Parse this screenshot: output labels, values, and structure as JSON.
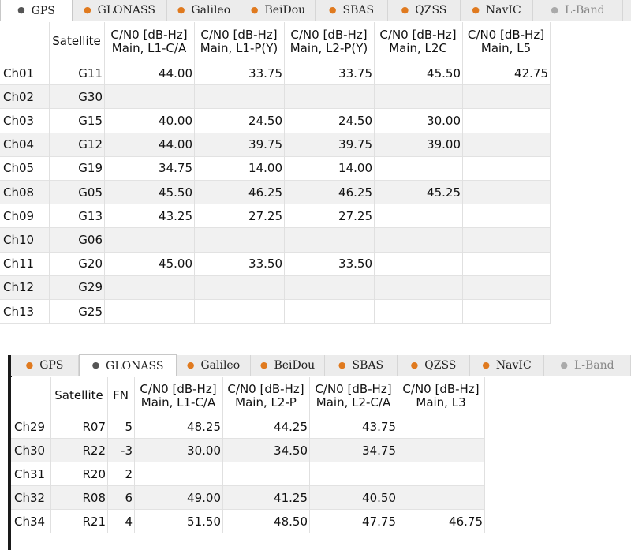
{
  "panel_gps": {
    "tabs": [
      {
        "label": "GPS",
        "dot_color": "#555555",
        "active": true
      },
      {
        "label": "GLONASS",
        "dot_color": "#e07a1f",
        "active": false
      },
      {
        "label": "Galileo",
        "dot_color": "#e07a1f",
        "active": false
      },
      {
        "label": "BeiDou",
        "dot_color": "#e07a1f",
        "active": false
      },
      {
        "label": "SBAS",
        "dot_color": "#e07a1f",
        "active": false
      },
      {
        "label": "QZSS",
        "dot_color": "#e07a1f",
        "active": false
      },
      {
        "label": "NavIC",
        "dot_color": "#e07a1f",
        "active": false
      },
      {
        "label": "L-Band",
        "dot_color": "#aaaaaa",
        "active": false
      }
    ],
    "headers": [
      "",
      "Satellite",
      "C/N0 [dB-Hz]\nMain, L1-C/A",
      "C/N0 [dB-Hz]\nMain, L1-P(Y)",
      "C/N0 [dB-Hz]\nMain, L2-P(Y)",
      "C/N0 [dB-Hz]\nMain, L2C",
      "C/N0 [dB-Hz]\nMain, L5"
    ],
    "rows": [
      [
        "Ch01",
        "G11",
        "44.00",
        "33.75",
        "33.75",
        "45.50",
        "42.75"
      ],
      [
        "Ch02",
        "G30",
        "",
        "",
        "",
        "",
        ""
      ],
      [
        "Ch03",
        "G15",
        "40.00",
        "24.50",
        "24.50",
        "30.00",
        ""
      ],
      [
        "Ch04",
        "G12",
        "44.00",
        "39.75",
        "39.75",
        "39.00",
        ""
      ],
      [
        "Ch05",
        "G19",
        "34.75",
        "14.00",
        "14.00",
        "",
        ""
      ],
      [
        "Ch08",
        "G05",
        "45.50",
        "46.25",
        "46.25",
        "45.25",
        ""
      ],
      [
        "Ch09",
        "G13",
        "43.25",
        "27.25",
        "27.25",
        "",
        ""
      ],
      [
        "Ch10",
        "G06",
        "",
        "",
        "",
        "",
        ""
      ],
      [
        "Ch11",
        "G20",
        "45.00",
        "33.50",
        "33.50",
        "",
        ""
      ],
      [
        "Ch12",
        "G29",
        "",
        "",
        "",
        "",
        ""
      ],
      [
        "Ch13",
        "G25",
        "",
        "",
        "",
        "",
        ""
      ]
    ]
  },
  "panel_glonass": {
    "tabs": [
      {
        "label": "GPS",
        "dot_color": "#e07a1f",
        "active": false
      },
      {
        "label": "GLONASS",
        "dot_color": "#555555",
        "active": true
      },
      {
        "label": "Galileo",
        "dot_color": "#e07a1f",
        "active": false
      },
      {
        "label": "BeiDou",
        "dot_color": "#e07a1f",
        "active": false
      },
      {
        "label": "SBAS",
        "dot_color": "#e07a1f",
        "active": false
      },
      {
        "label": "QZSS",
        "dot_color": "#e07a1f",
        "active": false
      },
      {
        "label": "NavIC",
        "dot_color": "#e07a1f",
        "active": false
      },
      {
        "label": "L-Band",
        "dot_color": "#aaaaaa",
        "active": false
      }
    ],
    "headers": [
      "",
      "Satellite",
      "FN",
      "C/N0 [dB-Hz]\nMain, L1-C/A",
      "C/N0 [dB-Hz]\nMain, L2-P",
      "C/N0 [dB-Hz]\nMain, L2-C/A",
      "C/N0 [dB-Hz]\nMain, L3"
    ],
    "rows": [
      [
        "Ch29",
        "R07",
        "5",
        "48.25",
        "44.25",
        "43.75",
        ""
      ],
      [
        "Ch30",
        "R22",
        "-3",
        "30.00",
        "34.50",
        "34.75",
        ""
      ],
      [
        "Ch31",
        "R20",
        "2",
        "",
        "",
        "",
        ""
      ],
      [
        "Ch32",
        "R08",
        "6",
        "49.00",
        "41.25",
        "40.50",
        ""
      ],
      [
        "Ch34",
        "R21",
        "4",
        "51.50",
        "48.50",
        "47.75",
        "46.75"
      ]
    ]
  }
}
